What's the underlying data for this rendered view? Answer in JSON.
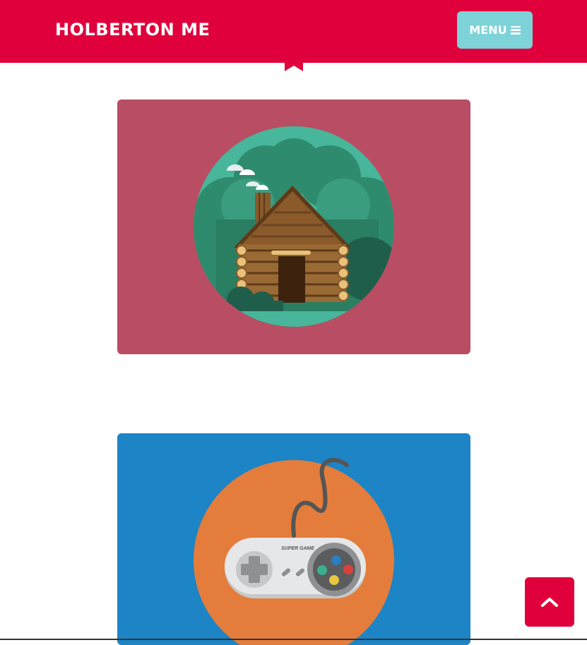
{
  "header": {
    "brand": "HOLBERTON ME",
    "menu_label": "MENU",
    "menu_icon": "bars-icon",
    "accent_icon": "bookmark-icon"
  },
  "portfolio": {
    "items": [
      {
        "illustration": "log-cabin-illustration",
        "icon": "cabin-icon"
      },
      {
        "illustration": "game-controller-illustration",
        "icon": "gamepad-icon",
        "controller_label": "SUPER GAME"
      }
    ]
  },
  "scroll_top": {
    "icon": "chevron-up-icon"
  },
  "colors": {
    "navbar": "#e0003c",
    "menu_button": "#7dd3d8",
    "card_1": "#b94d63",
    "card_2": "#1d84c5",
    "scroll_top": "#e0003c"
  }
}
